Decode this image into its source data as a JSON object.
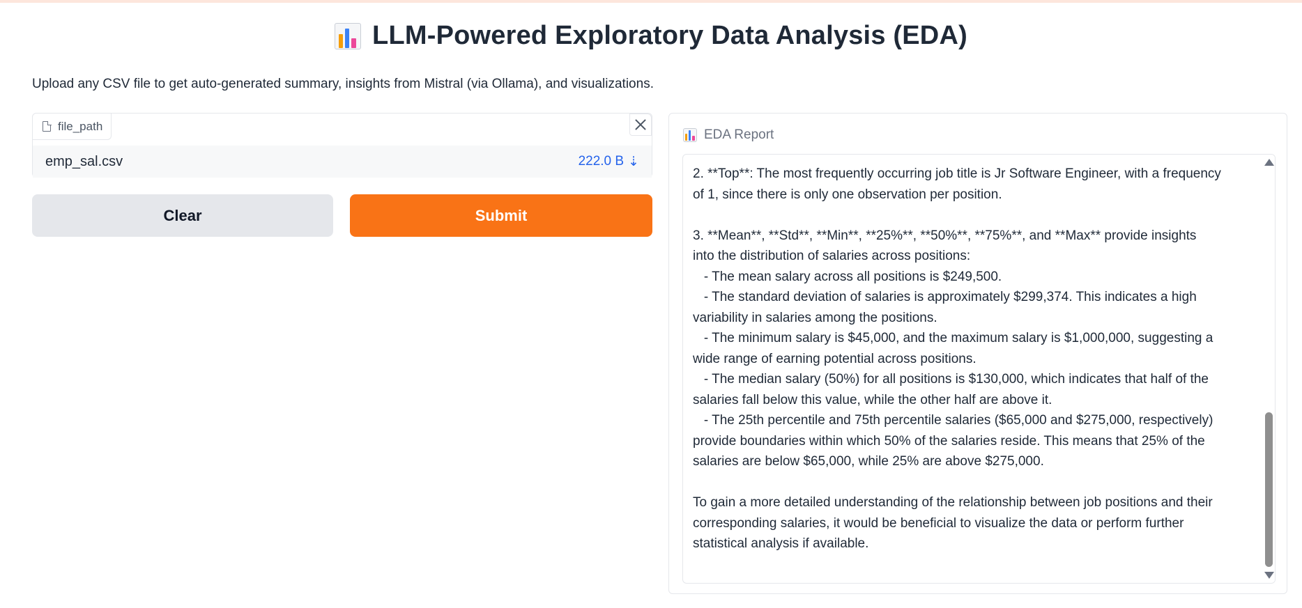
{
  "app": {
    "title": "LLM-Powered Exploratory Data Analysis (EDA)",
    "title_icon": "bar-chart-icon",
    "description": "Upload any CSV file to get auto-generated summary, insights from Mistral (via Ollama), and visualizations."
  },
  "file_input": {
    "label": "file_path",
    "file_name": "emp_sal.csv",
    "file_size": "222.0 B",
    "download_icon": "⇣"
  },
  "buttons": {
    "clear": "Clear",
    "submit": "Submit"
  },
  "report": {
    "label": "EDA Report",
    "content": "2. **Top**: The most frequently occurring job title is Jr Software Engineer, with a frequency\nof 1, since there is only one observation per position.\n\n3. **Mean**, **Std**, **Min**, **25%**, **50%**, **75%**, and **Max** provide insights\ninto the distribution of salaries across positions:\n   - The mean salary across all positions is $249,500.\n   - The standard deviation of salaries is approximately $299,374. This indicates a high\nvariability in salaries among the positions.\n   - The minimum salary is $45,000, and the maximum salary is $1,000,000, suggesting a\nwide range of earning potential across positions.\n   - The median salary (50%) for all positions is $130,000, which indicates that half of the\nsalaries fall below this value, while the other half are above it.\n   - The 25th percentile and 75th percentile salaries ($65,000 and $275,000, respectively)\nprovide boundaries within which 50% of the salaries reside. This means that 25% of the\nsalaries are below $65,000, while 25% are above $275,000.\n\nTo gain a more detailed understanding of the relationship between job positions and their\ncorresponding salaries, it would be beneficial to visualize the data or perform further\nstatistical analysis if available."
  },
  "colors": {
    "accent": "#f97316",
    "link": "#2563eb",
    "secondary_button": "#e5e7eb"
  }
}
